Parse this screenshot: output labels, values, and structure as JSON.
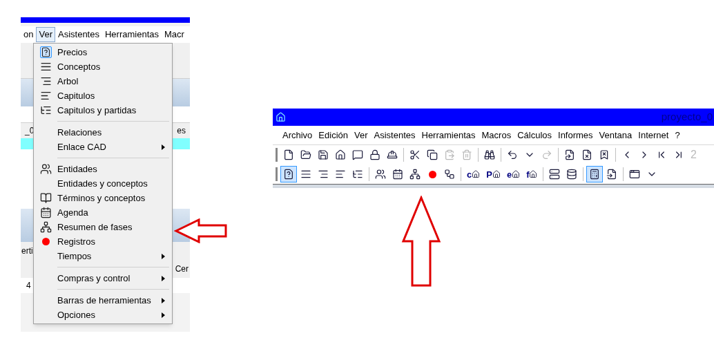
{
  "left_window": {
    "menubar": [
      {
        "label": "on",
        "selected": false
      },
      {
        "label": "Ver",
        "selected": true
      },
      {
        "label": "Asistentes",
        "selected": false
      },
      {
        "label": "Herramientas",
        "selected": false
      },
      {
        "label": "Macr",
        "selected": false
      }
    ],
    "background_texts": {
      "tab_fragment": "es",
      "row_fragment": "_0",
      "left_fragment": "erti",
      "number_fragment": "4",
      "button_fragment": "Cer"
    },
    "dropdown_menu": {
      "groups": [
        [
          {
            "label": "Precios",
            "submenu": false,
            "selected": true
          },
          {
            "label": "Conceptos",
            "submenu": false,
            "selected": false
          },
          {
            "label": "Arbol",
            "submenu": false,
            "selected": false
          },
          {
            "label": "Capitulos",
            "submenu": false,
            "selected": false
          },
          {
            "label": "Capitulos y partidas",
            "submenu": false,
            "selected": false
          }
        ],
        [
          {
            "label": "Relaciones",
            "submenu": false,
            "selected": false
          },
          {
            "label": "Enlace CAD",
            "submenu": true,
            "selected": false
          }
        ],
        [
          {
            "label": "Entidades",
            "submenu": false,
            "selected": false
          },
          {
            "label": "Entidades y conceptos",
            "submenu": false,
            "selected": false
          },
          {
            "label": "Términos y conceptos",
            "submenu": false,
            "selected": false
          },
          {
            "label": "Agenda",
            "submenu": false,
            "selected": false
          },
          {
            "label": "Resumen de fases",
            "submenu": false,
            "selected": false
          },
          {
            "label": "Registros",
            "submenu": false,
            "selected": false
          },
          {
            "label": "Tiempos",
            "submenu": true,
            "selected": false
          }
        ],
        [
          {
            "label": "Compras y control",
            "submenu": true,
            "selected": false
          }
        ],
        [
          {
            "label": "Barras de herramientas",
            "submenu": true,
            "selected": false
          },
          {
            "label": "Opciones",
            "submenu": true,
            "selected": false
          }
        ]
      ]
    }
  },
  "right_window": {
    "title": "proyecto_0",
    "menubar": [
      "Archivo",
      "Edición",
      "Ver",
      "Asistentes",
      "Herramientas",
      "Macros",
      "Cálculos",
      "Informes",
      "Ventana",
      "Internet",
      "?"
    ],
    "toolbar_1": [
      {
        "kind": "button",
        "disabled": false
      },
      {
        "kind": "button",
        "disabled": false
      },
      {
        "kind": "button",
        "disabled": false
      },
      {
        "kind": "button",
        "disabled": false
      },
      {
        "kind": "button",
        "disabled": false
      },
      {
        "kind": "button",
        "disabled": false
      },
      {
        "kind": "button",
        "disabled": false
      },
      {
        "kind": "separator"
      },
      {
        "kind": "button",
        "disabled": false
      },
      {
        "kind": "button",
        "disabled": false
      },
      {
        "kind": "button",
        "disabled": true
      },
      {
        "kind": "button",
        "disabled": true
      },
      {
        "kind": "separator"
      },
      {
        "kind": "button",
        "disabled": false
      },
      {
        "kind": "separator"
      },
      {
        "kind": "button",
        "disabled": false
      },
      {
        "kind": "button",
        "disabled": false
      },
      {
        "kind": "button",
        "disabled": true
      },
      {
        "kind": "separator"
      },
      {
        "kind": "button",
        "disabled": false
      },
      {
        "kind": "button",
        "disabled": false
      },
      {
        "kind": "button",
        "disabled": false
      },
      {
        "kind": "separator"
      },
      {
        "kind": "button",
        "disabled": false
      },
      {
        "kind": "button",
        "disabled": false
      },
      {
        "kind": "button",
        "disabled": false
      },
      {
        "kind": "button",
        "disabled": false
      },
      {
        "kind": "text",
        "label": "2"
      }
    ],
    "toolbar_2": [
      {
        "kind": "button",
        "pressed": true
      },
      {
        "kind": "button",
        "pressed": false
      },
      {
        "kind": "button",
        "pressed": false
      },
      {
        "kind": "button",
        "pressed": false
      },
      {
        "kind": "button",
        "pressed": false
      },
      {
        "kind": "separator"
      },
      {
        "kind": "button",
        "pressed": false
      },
      {
        "kind": "button",
        "pressed": false
      },
      {
        "kind": "button",
        "pressed": false
      },
      {
        "kind": "dot",
        "pressed": false
      },
      {
        "kind": "button",
        "pressed": false
      },
      {
        "kind": "separator"
      },
      {
        "kind": "letter",
        "label": "c",
        "pressed": false
      },
      {
        "kind": "letter",
        "label": "P",
        "pressed": false
      },
      {
        "kind": "letter",
        "label": "e",
        "pressed": false
      },
      {
        "kind": "letter",
        "label": "f",
        "pressed": false
      },
      {
        "kind": "separator"
      },
      {
        "kind": "button",
        "pressed": false
      },
      {
        "kind": "button",
        "pressed": false
      },
      {
        "kind": "separator"
      },
      {
        "kind": "button",
        "pressed": true
      },
      {
        "kind": "button",
        "pressed": false
      },
      {
        "kind": "separator"
      },
      {
        "kind": "button",
        "pressed": false
      },
      {
        "kind": "button",
        "pressed": false
      }
    ]
  }
}
